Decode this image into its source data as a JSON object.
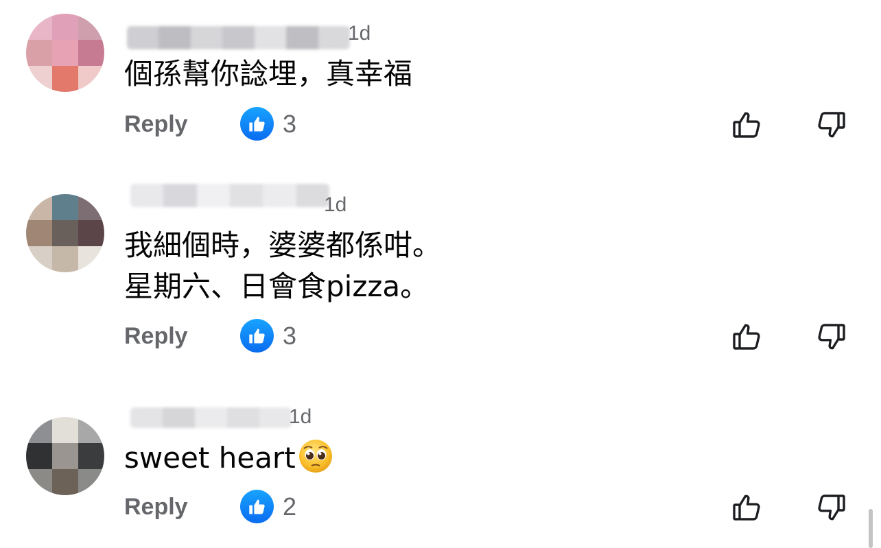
{
  "comments": [
    {
      "time": "1d",
      "text_lines": [
        "個孫幫你諗埋，真幸福"
      ],
      "reply_label": "Reply",
      "like_count": "3",
      "avatar_colors": [
        "#e8b6c6",
        "#e0a0b8",
        "#cf9fae",
        "#d9a0a8",
        "#e7a2b3",
        "#c77b93",
        "#efd0d0",
        "#e2796b",
        "#f0c9c9"
      ]
    },
    {
      "time": "1d",
      "text_lines": [
        "我細個時，婆婆都係咁。",
        "星期六、日會食pizza。"
      ],
      "reply_label": "Reply",
      "like_count": "3",
      "avatar_colors": [
        "#c9b6a6",
        "#5f7f8c",
        "#7d6e74",
        "#9f8675",
        "#6a605b",
        "#5c4548",
        "#d8cfc6",
        "#c6b8a8",
        "#e9e3dd"
      ]
    },
    {
      "time": "1d",
      "text_lines": [
        "sweet heart"
      ],
      "reply_label": "Reply",
      "like_count": "2",
      "avatar_colors": [
        "#8d8f92",
        "#e2ded8",
        "#a8a8a8",
        "#2f3133",
        "#9a9590",
        "#3a3c3e",
        "#8c8a87",
        "#6d6258",
        "#8a8a88"
      ]
    }
  ],
  "icons": {
    "like_badge": "thumbs-up-filled-icon",
    "like_button": "thumbs-up-outline-icon",
    "dislike_button": "thumbs-down-outline-icon",
    "emoji": "pleading-face-emoji"
  },
  "colors": {
    "accent_blue": "#0a6cf0",
    "secondary_text": "#65676b",
    "primary_text": "#050505"
  }
}
